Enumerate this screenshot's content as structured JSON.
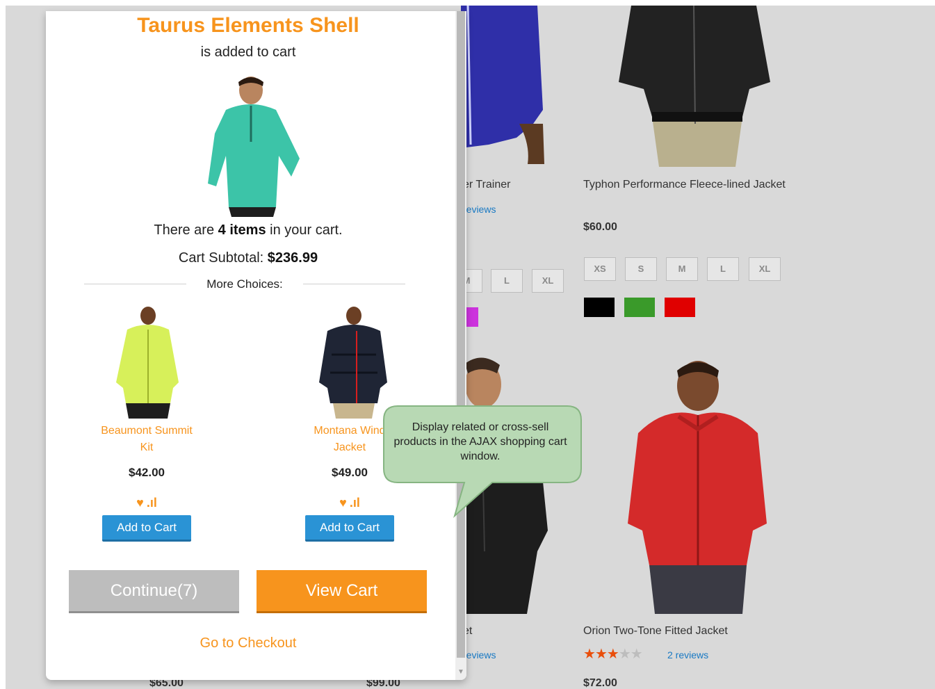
{
  "popup": {
    "title": "Taurus Elements Shell",
    "subtitle": "is added to cart",
    "cart_count_prefix": "There are ",
    "cart_count": "4 items",
    "cart_count_suffix": " in your cart.",
    "subtotal_label": "Cart Subtotal: ",
    "subtotal_value": "$236.99",
    "more_choices_label": "More Choices:",
    "related": [
      {
        "name": "Beaumont Summit Kit",
        "price": "$42.00",
        "button": "Add to Cart",
        "color": "lime-jacket"
      },
      {
        "name": "Montana Wind Jacket",
        "price": "$49.00",
        "button": "Add to Cart",
        "color": "dark-jacket"
      }
    ],
    "continue_label": "Continue(7)",
    "view_cart_label": "View Cart",
    "checkout_label": "Go to Checkout"
  },
  "callout": {
    "text": "Display related or cross-sell products in the AJAX shopping cart window."
  },
  "background": {
    "products": [
      {
        "name": "er Trainer",
        "reviews": "reviews"
      },
      {
        "name": "Typhon Performance Fleece-lined Jacket",
        "price": "$60.00"
      },
      {
        "name": "et",
        "reviews": "reviews"
      },
      {
        "name": "Orion Two-Tone Fitted Jacket",
        "reviews": "2 reviews",
        "price": "$72.00",
        "rating": "2.5 of 5"
      }
    ],
    "sizes_left": [
      "M",
      "L",
      "XL"
    ],
    "sizes_right": [
      "XS",
      "S",
      "M",
      "L",
      "XL"
    ],
    "swatch_colors": [
      "#000000",
      "#3a9a2a",
      "#e00000"
    ],
    "left_swatch_color": "#cc33dd",
    "bottom_prices": [
      "$65.00",
      "$99.00"
    ]
  },
  "colors": {
    "accent": "#f7941d",
    "button_blue": "#2a93d5",
    "link_blue": "#1979c3"
  }
}
